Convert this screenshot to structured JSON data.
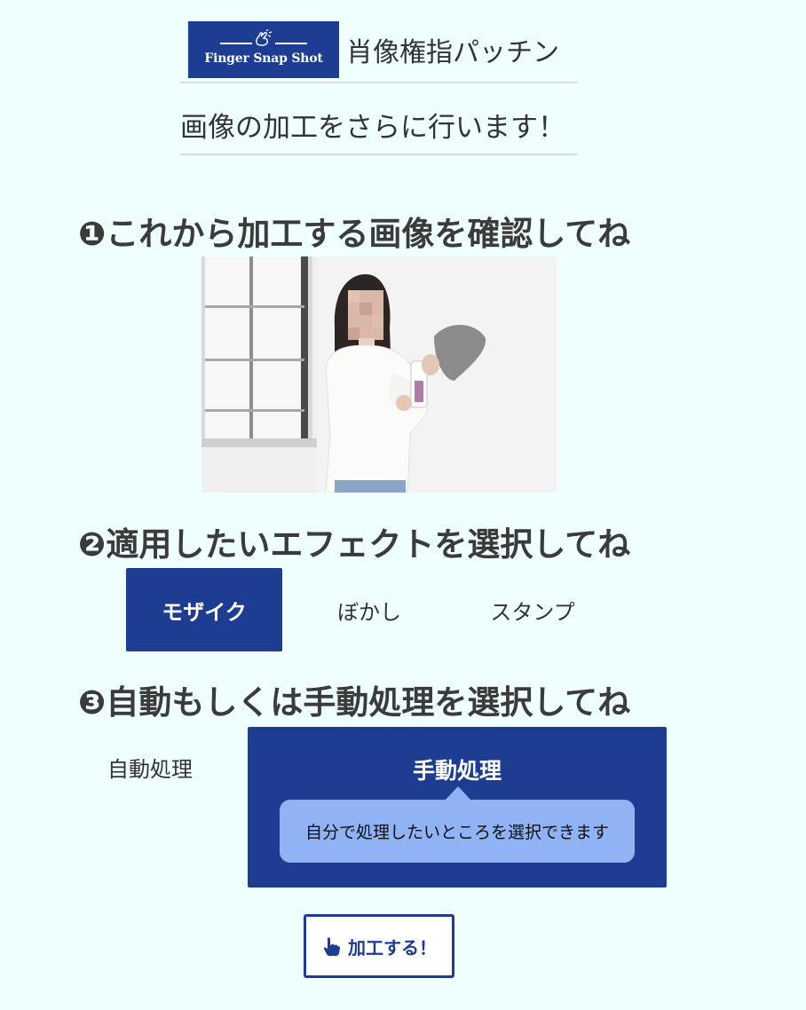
{
  "header": {
    "logo_text": "Finger Snap Shot",
    "app_title": "肖像権指パッチン",
    "subtitle": "画像の加工をさらに行います！"
  },
  "steps": {
    "step1": "❶これから加工する画像を確認してね",
    "step2": "❷適用したいエフェクトを選択してね",
    "step3": "❸自動もしくは手動処理を選択してね"
  },
  "effects": {
    "selected": "mosaic",
    "options": [
      {
        "id": "mosaic",
        "label": "モザイク"
      },
      {
        "id": "blur",
        "label": "ぼかし"
      },
      {
        "id": "stamp",
        "label": "スタンプ"
      }
    ]
  },
  "processing": {
    "selected": "manual",
    "auto_label": "自動処理",
    "manual_label": "手動処理",
    "manual_tip": "自分で処理したいところを選択できます"
  },
  "action": {
    "process_label": "加工する！"
  },
  "colors": {
    "accent": "#1d3d92",
    "background": "#eefffe",
    "tip": "#8fb3f5"
  }
}
